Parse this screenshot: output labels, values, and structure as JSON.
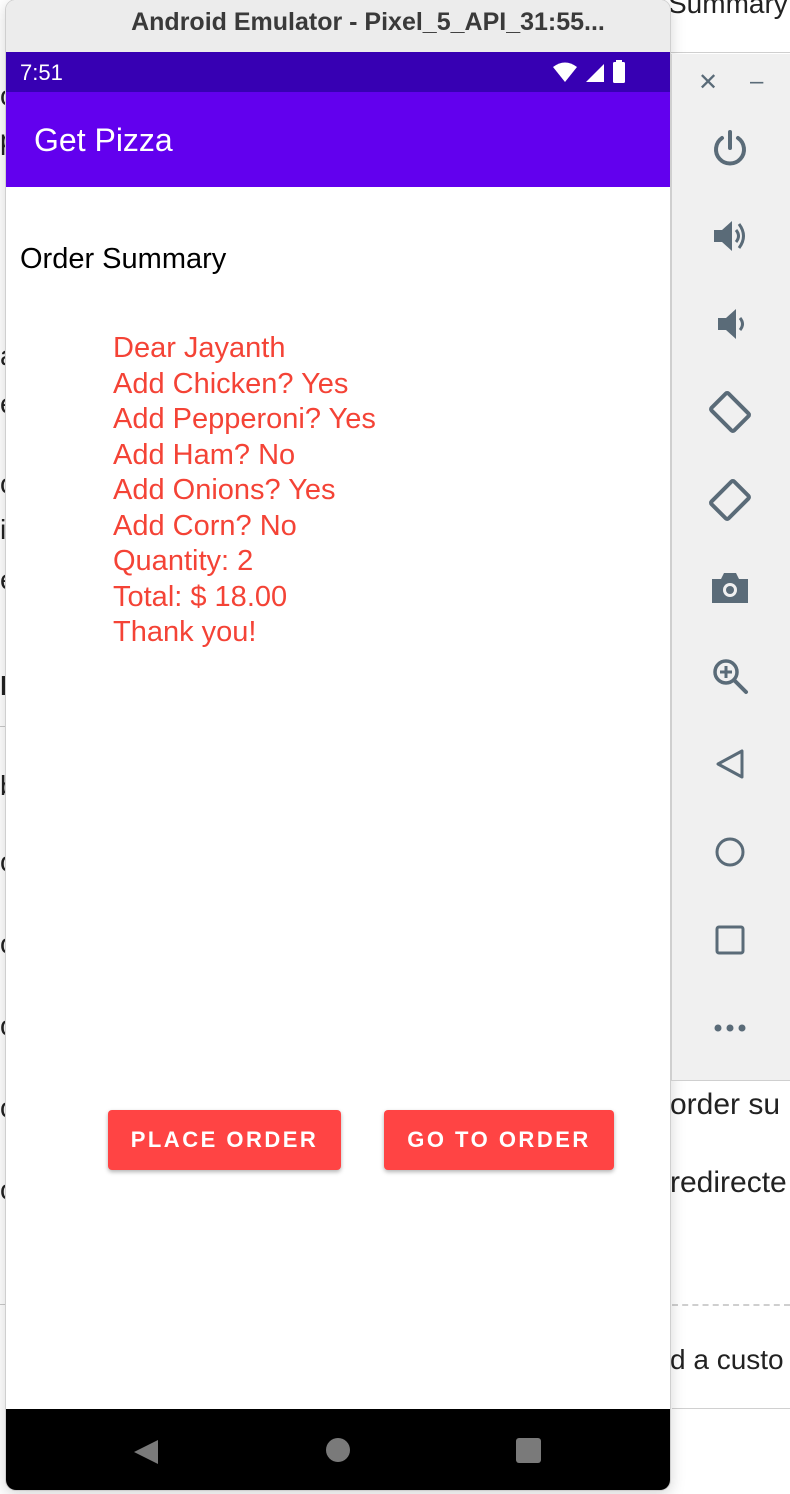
{
  "background_window": {
    "header_fragment": "Summary",
    "left_fragments": [
      "o",
      "p",
      "a",
      "e",
      "o",
      "i",
      "e",
      "I",
      "b",
      "o",
      "o",
      "o",
      "o",
      "o"
    ],
    "right_text_1": "order su",
    "right_text_2": "redirecte",
    "right_text_3": "d a custo"
  },
  "emulator": {
    "window_title": "Android Emulator - Pixel_5_API_31:55...",
    "status_bar": {
      "time": "7:51"
    },
    "app_bar": {
      "title": "Get Pizza"
    },
    "content": {
      "heading": "Order Summary",
      "summary_lines": [
        "Dear Jayanth",
        "Add Chicken? Yes",
        "Add Pepperoni? Yes",
        "Add Ham? No",
        "Add Onions? Yes",
        "Add Corn? No",
        "Quantity: 2",
        "Total: $ 18.00",
        "Thank you!"
      ],
      "buttons": {
        "place_order": "PLACE ORDER",
        "go_to_order": "GO TO ORDER"
      }
    }
  },
  "toolbar_icons": [
    "power-icon",
    "volume-up-icon",
    "volume-down-icon",
    "rotate-left-icon",
    "rotate-right-icon",
    "camera-icon",
    "zoom-icon",
    "back-icon",
    "home-icon",
    "overview-icon",
    "more-icon"
  ],
  "colors": {
    "status_bar": "#3700b3",
    "app_bar": "#6200ee",
    "summary_text": "#f44336",
    "button": "#ff4444"
  }
}
